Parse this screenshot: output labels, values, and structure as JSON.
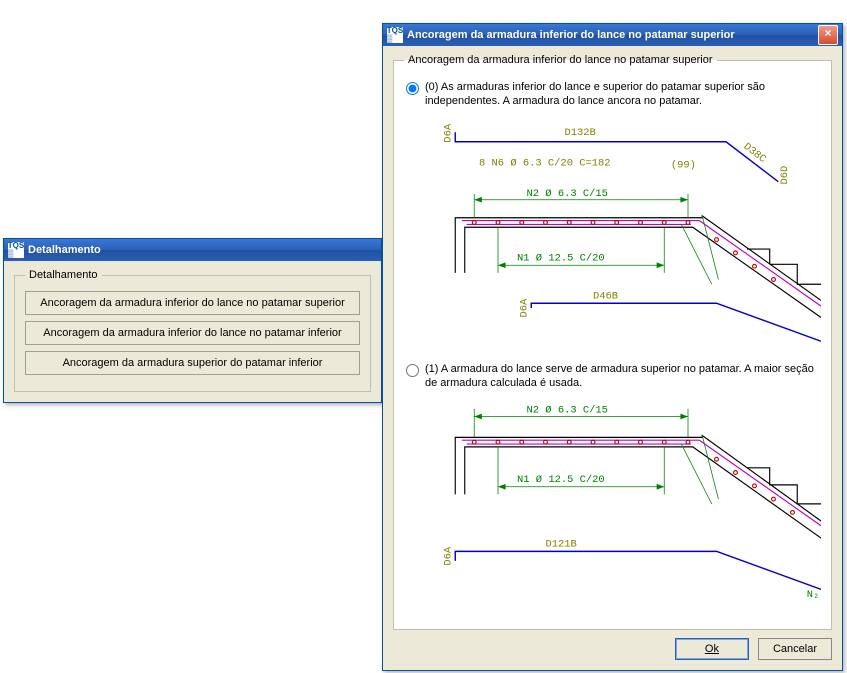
{
  "detal_window": {
    "title": "Detalhamento",
    "group_legend": "Detalhamento",
    "buttons": [
      "Ancoragem da armadura inferior do lance no patamar superior",
      "Ancoragem da armadura inferior do lance no patamar inferior",
      "Ancoragem da armadura superior do patamar inferior"
    ]
  },
  "anchor_window": {
    "title": "Ancoragem da armadura inferior do lance no patamar superior",
    "group_legend": "Ancoragem da armadura inferior do lance no patamar superior",
    "options": [
      {
        "label": "(0) As armaduras inferior do lance e superior do patamar superior são independentes. A armadura do lance ancora no patamar.",
        "selected": true,
        "diagram": {
          "bar_label_top": "D132B",
          "bar_label_diag": "D38C",
          "side_left": "D6A",
          "side_right": "D6D",
          "bar_spec": "8 N6 Ø 6.3 C/20 C=182",
          "bar_small": "(99)",
          "n2_spec": "N2 Ø 6.3 C/15",
          "n1_spec": "N1 Ø 12.5 C/20",
          "lower_bar_label": "D46B",
          "lower_side": "D6A"
        }
      },
      {
        "label": "(1) A armadura do lance serve de armadura superior no patamar. A maior seção de armadura calculada é usada.",
        "selected": false,
        "diagram": {
          "n2_spec": "N2 Ø 6.3 C/15",
          "n1_spec": "N1 Ø 12.5 C/20",
          "lower_bar_label": "D121B",
          "lower_side": "D6A",
          "right_label": "N₂"
        }
      }
    ],
    "ok_label": "Ok",
    "cancel_label": "Cancelar"
  }
}
